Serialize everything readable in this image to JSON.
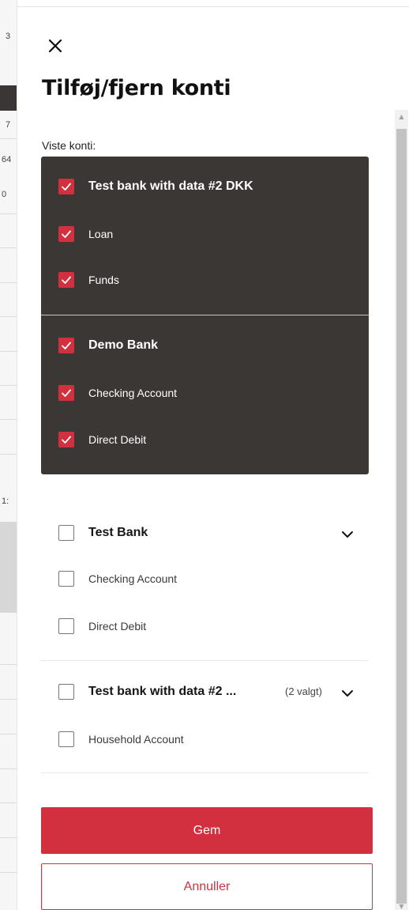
{
  "panel": {
    "title": "Tilføj/fjern konti",
    "close_icon": "close-icon"
  },
  "selected_section": {
    "label": "Viste konti:",
    "groups": [
      {
        "name": "Test bank with data #2 DKK",
        "checked": true,
        "accounts": [
          {
            "name": "Loan",
            "checked": true
          },
          {
            "name": "Funds",
            "checked": true
          }
        ]
      },
      {
        "name": "Demo Bank",
        "checked": true,
        "accounts": [
          {
            "name": "Checking Account",
            "checked": true
          },
          {
            "name": "Direct Debit",
            "checked": true
          }
        ]
      }
    ]
  },
  "other_section": {
    "groups": [
      {
        "name": "Test Bank",
        "checked": false,
        "accounts": [
          {
            "name": "Checking Account",
            "checked": false
          },
          {
            "name": "Direct Debit",
            "checked": false
          }
        ]
      },
      {
        "name": "Test bank with data #2 ...",
        "selected_count": "(2 valgt)",
        "checked": false,
        "accounts": [
          {
            "name": "Household Account",
            "checked": false
          }
        ]
      }
    ]
  },
  "actions": {
    "save_label": "Gem",
    "cancel_label": "Annuller"
  },
  "colors": {
    "accent": "#d3303f",
    "selected_bg": "#3b3735"
  },
  "background_fragments": [
    "3",
    "7",
    "64",
    "0",
    "1:"
  ]
}
